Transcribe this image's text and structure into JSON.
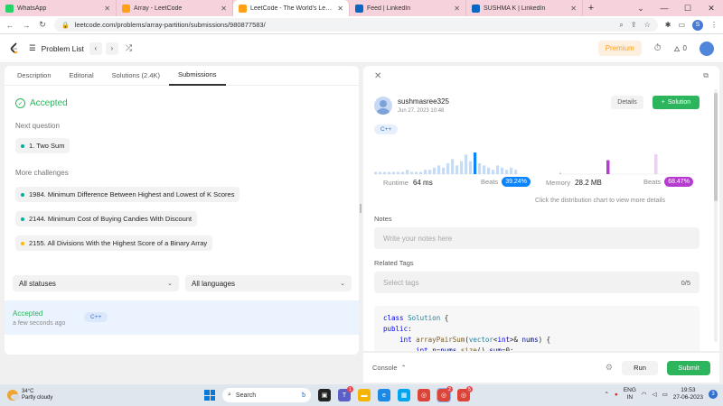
{
  "browser": {
    "tabs": [
      {
        "title": "WhatsApp",
        "icon": "whatsapp-icon",
        "color": "#25d366",
        "active": false
      },
      {
        "title": "Array - LeetCode",
        "icon": "leetcode-icon",
        "color": "#ffa116",
        "active": false
      },
      {
        "title": "LeetCode - The World's Leading",
        "icon": "leetcode-icon",
        "color": "#ffa116",
        "active": true
      },
      {
        "title": "Feed | LinkedIn",
        "icon": "linkedin-icon",
        "color": "#0a66c2",
        "active": false
      },
      {
        "title": "SUSHMA K | LinkedIn",
        "icon": "linkedin-icon",
        "color": "#0a66c2",
        "active": false
      }
    ],
    "url": "leetcode.com/problems/array-partition/submissions/980877583/",
    "profile_initial": "S"
  },
  "lcnav": {
    "problem_list": "Problem List",
    "premium": "Premium",
    "streak": "0"
  },
  "left": {
    "tabs": [
      "Description",
      "Editorial",
      "Solutions (2.4K)",
      "Submissions"
    ],
    "active_tab": 3,
    "accepted": "Accepted",
    "next_question_label": "Next question",
    "next_question": "1. Two Sum",
    "more_challenges_label": "More challenges",
    "challenges": [
      {
        "title": "1984. Minimum Difference Between Highest and Lowest of K Scores",
        "difficulty_color": "#00af9b"
      },
      {
        "title": "2144. Minimum Cost of Buying Candies With Discount",
        "difficulty_color": "#00af9b"
      },
      {
        "title": "2155. All Divisions With the Highest Score of a Binary Array",
        "difficulty_color": "#ffb800"
      }
    ],
    "filters": {
      "status": "All statuses",
      "language": "All languages"
    },
    "submission": {
      "status": "Accepted",
      "time": "a few seconds ago",
      "lang": "C++"
    }
  },
  "right": {
    "username": "sushmasree325",
    "date": "Jun 27, 2023 10:48",
    "details": "Details",
    "solution": "Solution",
    "lang": "C++",
    "runtime_label": "Runtime",
    "runtime_value": "64 ms",
    "runtime_beats_label": "Beats",
    "runtime_beats": "39.24%",
    "memory_label": "Memory",
    "memory_value": "28.2 MB",
    "memory_beats_label": "Beats",
    "memory_beats": "68.47%",
    "dist_hint": "Click the distribution chart to view more details",
    "notes_label": "Notes",
    "notes_placeholder": "Write your notes here",
    "tags_label": "Related Tags",
    "tags_placeholder": "Select tags",
    "tags_count": "0/5",
    "runtime_hist": [
      1,
      1,
      1,
      1,
      1,
      1,
      1,
      2,
      1,
      1,
      1,
      2,
      2,
      3,
      4,
      3,
      5,
      7,
      4,
      6,
      9,
      6,
      10,
      5,
      4,
      3,
      2,
      4,
      3,
      2,
      3,
      2
    ],
    "runtime_highlight_index": 22,
    "memory_hist_heights": [
      0.7,
      1.0
    ],
    "accent_runtime": "#0a84ff",
    "accent_memory": "#b73bd0"
  },
  "code": {
    "lines": [
      [
        {
          "t": "class ",
          "c": "kw"
        },
        {
          "t": "Solution",
          "c": "ty"
        },
        {
          "t": " {",
          "c": ""
        }
      ],
      [
        {
          "t": "public",
          "c": "kw"
        },
        {
          "t": ":",
          "c": ""
        }
      ],
      [
        {
          "t": "    ",
          "c": ""
        },
        {
          "t": "int ",
          "c": "kw"
        },
        {
          "t": "arrayPairSum",
          "c": "fn"
        },
        {
          "t": "(",
          "c": ""
        },
        {
          "t": "vector",
          "c": "ty"
        },
        {
          "t": "<",
          "c": ""
        },
        {
          "t": "int",
          "c": "kw"
        },
        {
          "t": ">& ",
          "c": ""
        },
        {
          "t": "nums",
          "c": "vr"
        },
        {
          "t": ") {",
          "c": ""
        }
      ],
      [
        {
          "t": "        ",
          "c": ""
        },
        {
          "t": "int ",
          "c": "kw"
        },
        {
          "t": "n",
          "c": "vr"
        },
        {
          "t": "=",
          "c": ""
        },
        {
          "t": "nums",
          "c": "vr"
        },
        {
          "t": ".",
          "c": ""
        },
        {
          "t": "size",
          "c": "fn"
        },
        {
          "t": "(),",
          "c": ""
        },
        {
          "t": "sum",
          "c": "vr"
        },
        {
          "t": "=0;",
          "c": ""
        }
      ]
    ]
  },
  "console": {
    "console_label": "Console",
    "run": "Run",
    "submit": "Submit"
  },
  "taskbar": {
    "temp": "34°C",
    "weather": "Partly cloudy",
    "search": "Search",
    "lang1": "ENG",
    "lang2": "IN",
    "time": "19:53",
    "date": "27-06-2023",
    "notifications": "3"
  }
}
